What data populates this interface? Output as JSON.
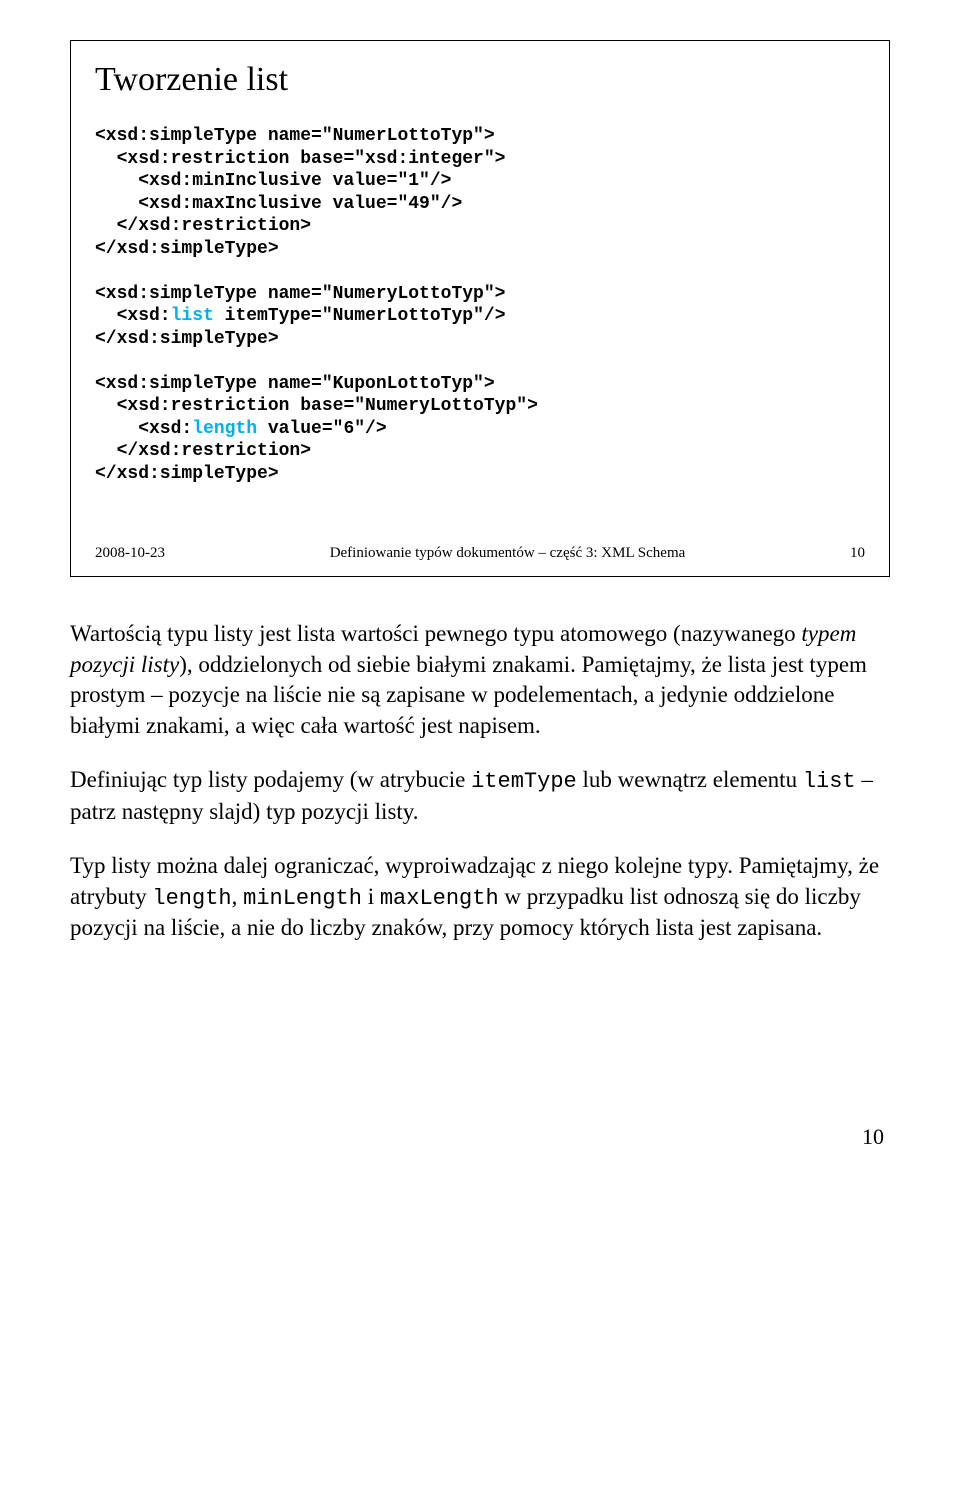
{
  "slide": {
    "title": "Tworzenie list",
    "code_lines": [
      {
        "t": "<xsd:simpleType name=\"NumerLottoTyp\">"
      },
      {
        "t": "  <xsd:restriction base=\"xsd:integer\">"
      },
      {
        "t": "    <xsd:minInclusive value=\"1\"/>"
      },
      {
        "t": "    <xsd:maxInclusive value=\"49\"/>"
      },
      {
        "t": "  </xsd:restriction>"
      },
      {
        "t": "</xsd:simpleType>"
      },
      {
        "t": ""
      },
      {
        "t": "<xsd:simpleType name=\"NumeryLottoTyp\">"
      },
      {
        "pre": "  <xsd:",
        "hl": "list",
        "post": " itemType=\"NumerLottoTyp\"/>"
      },
      {
        "t": "</xsd:simpleType>"
      },
      {
        "t": ""
      },
      {
        "t": "<xsd:simpleType name=\"KuponLottoTyp\">"
      },
      {
        "t": "  <xsd:restriction base=\"NumeryLottoTyp\">"
      },
      {
        "pre": "    <xsd:",
        "hl": "length",
        "post": " value=\"6\"/>"
      },
      {
        "t": "  </xsd:restriction>"
      },
      {
        "t": "</xsd:simpleType>"
      }
    ],
    "footer_date": "2008-10-23",
    "footer_title": "Definiowanie typów dokumentów – część 3: XML Schema",
    "footer_page": "10"
  },
  "body": {
    "p1_a": "Wartością typu listy jest lista wartości pewnego typu atomowego (nazywanego ",
    "p1_ital": "typem pozycji listy",
    "p1_b": "), oddzielonych od siebie białymi znakami. Pamiętajmy, że lista jest typem prostym – pozycje na liście nie są zapisane w podelementach, a jedynie oddzielone białymi znakami, a więc cała wartość jest napisem.",
    "p2_a": "Definiując typ listy podajemy (w atrybucie ",
    "p2_code1": "itemType",
    "p2_b": " lub wewnątrz elementu ",
    "p2_code2": "list",
    "p2_c": " – patrz następny slajd) typ pozycji listy.",
    "p3_a": "Typ listy można dalej ograniczać, wyproiwadzając z niego kolejne typy. Pamiętajmy, że atrybuty ",
    "p3_code1": "length",
    "p3_b": ", ",
    "p3_code2": "minLength",
    "p3_c": " i ",
    "p3_code3": "maxLength",
    "p3_d": " w przypadku list odnoszą się do liczby pozycji na liście, a nie do liczby znaków, przy pomocy których lista jest zapisana."
  },
  "page_number": "10"
}
